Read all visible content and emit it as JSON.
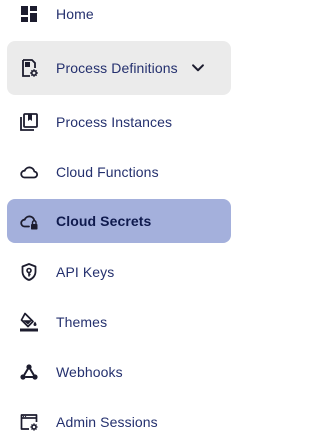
{
  "sidebar": {
    "items": [
      {
        "label": "Home",
        "icon": "dashboard-icon"
      },
      {
        "label": "Process Definitions",
        "icon": "process-definitions-icon",
        "expandable": true,
        "expanded": true
      },
      {
        "label": "Process Instances",
        "icon": "process-instances-icon"
      },
      {
        "label": "Cloud Functions",
        "icon": "cloud-icon"
      },
      {
        "label": "Cloud Secrets",
        "icon": "cloud-lock-icon",
        "active": true
      },
      {
        "label": "API Keys",
        "icon": "shield-key-icon"
      },
      {
        "label": "Themes",
        "icon": "paint-bucket-icon"
      },
      {
        "label": "Webhooks",
        "icon": "webhook-icon"
      },
      {
        "label": "Admin Sessions",
        "icon": "admin-settings-icon"
      }
    ]
  },
  "colors": {
    "text": "#24306e",
    "active_bg": "#a4b0dc",
    "expanded_bg": "#ebebeb",
    "icon": "#1c1c2e"
  }
}
